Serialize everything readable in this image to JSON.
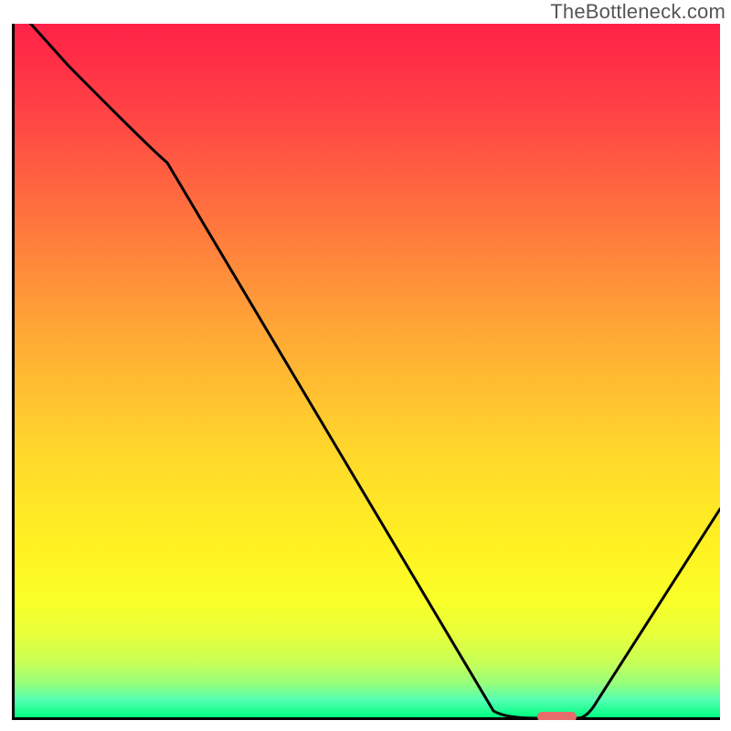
{
  "watermark": "TheBottleneck.com",
  "chart_data": {
    "type": "line",
    "title": "",
    "xlabel": "",
    "ylabel": "",
    "xlim": [
      0,
      100
    ],
    "ylim": [
      0,
      100
    ],
    "x": [
      0,
      8,
      22,
      68,
      74,
      80,
      100
    ],
    "y": [
      103,
      94,
      80,
      1,
      0,
      0,
      30
    ],
    "optimum_marker": {
      "x": 77,
      "y": 0,
      "width": 5.5,
      "height": 1.5
    },
    "gradient": {
      "top": "#ff2247",
      "bottom": "#00ff80",
      "description": "red-orange-yellow-green vertical spectrum"
    },
    "notes": "V-shaped bottleneck curve; flat bottom around x 74-80; optimum marker at bottom; no axis ticks or labels present"
  }
}
